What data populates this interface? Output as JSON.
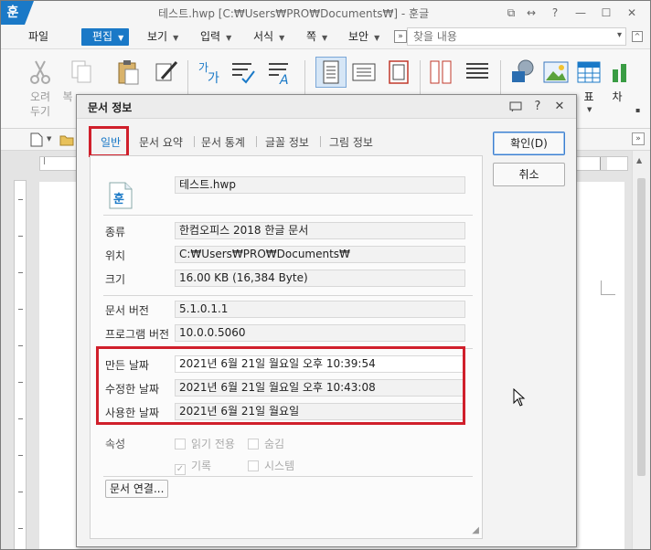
{
  "app": {
    "logo_char": "훈",
    "window_title": "테스트.hwp [C:₩Users₩PRO₩Documents₩] - 훈글",
    "window_controls": [
      "⧉",
      "↔",
      "?",
      "—",
      "☐",
      "✕"
    ]
  },
  "menu": {
    "items": [
      {
        "label": "파일",
        "has_arrow": false
      },
      {
        "label": "편집",
        "has_arrow": true,
        "active": true
      },
      {
        "label": "보기",
        "has_arrow": true
      },
      {
        "label": "입력",
        "has_arrow": true
      },
      {
        "label": "서식",
        "has_arrow": true
      },
      {
        "label": "쪽",
        "has_arrow": true
      },
      {
        "label": "보안",
        "has_arrow": true
      }
    ],
    "more": "»",
    "find_placeholder": "찾을 내용"
  },
  "ribbon": {
    "cut_label": "오려\n두기",
    "copy_label": "복"
  },
  "side_labels": {
    "table": "표",
    "chart": "차"
  },
  "dialog": {
    "title": "문서 정보",
    "tabs": [
      "일반",
      "문서 요약",
      "문서 통계",
      "글꼴 정보",
      "그림 정보"
    ],
    "filename": "테스트.hwp",
    "fields": [
      {
        "label": "종류",
        "value": "한컴오피스 2018 한글 문서"
      },
      {
        "label": "위치",
        "value": "C:₩Users₩PRO₩Documents₩"
      },
      {
        "label": "크기",
        "value": "16.00 KB (16,384 Byte)"
      }
    ],
    "version_fields": [
      {
        "label": "문서 버전",
        "value": "5.1.0.1.1"
      },
      {
        "label": "프로그램 버전",
        "value": "10.0.0.5060"
      }
    ],
    "date_fields": [
      {
        "label": "만든 날짜",
        "value": "2021년 6월 21일 월요일 오후 10:39:54"
      },
      {
        "label": "수정한 날짜",
        "value": "2021년 6월 21일 월요일 오후 10:43:08"
      },
      {
        "label": "사용한 날짜",
        "value": "2021년 6월 21일 월요일"
      }
    ],
    "attributes_label": "속성",
    "attributes": [
      {
        "label": "읽기 전용",
        "checked": false
      },
      {
        "label": "숨김",
        "checked": false
      },
      {
        "label": "기록",
        "checked": true
      },
      {
        "label": "시스템",
        "checked": false
      }
    ],
    "link_button": "문서 연결...",
    "ok_button": "확인(D)",
    "cancel_button": "취소"
  },
  "colors": {
    "accent": "#1a79c7",
    "highlight": "#d01f2b"
  }
}
